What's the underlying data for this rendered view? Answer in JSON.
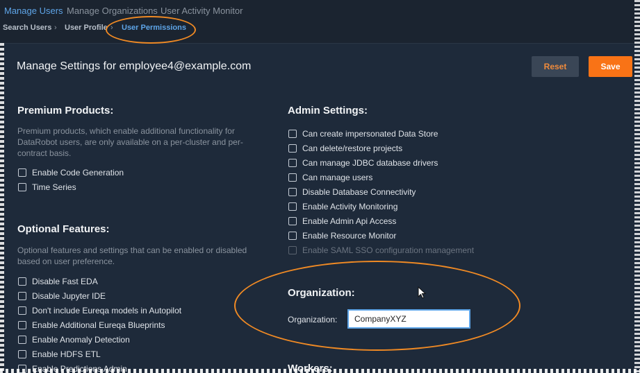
{
  "top_nav": {
    "tabs": [
      "Manage Users",
      "Manage Organizations",
      "User Activity Monitor"
    ],
    "active_tab": "Manage Users"
  },
  "breadcrumb": {
    "items": [
      "Search Users",
      "User Profile",
      "User Permissions"
    ],
    "separator": "›"
  },
  "panel": {
    "title": "Manage Settings for employee4@example.com",
    "reset_label": "Reset",
    "save_label": "Save"
  },
  "premium": {
    "title": "Premium Products:",
    "description": "Premium products, which enable additional functionality for DataRobot users, are only available on a per-cluster and per-contract basis.",
    "options": [
      "Enable Code Generation",
      "Time Series"
    ]
  },
  "optional": {
    "title": "Optional Features:",
    "description": "Optional features and settings that can be enabled or disabled based on user preference.",
    "options": [
      "Disable Fast EDA",
      "Disable Jupyter IDE",
      "Don't include Eureqa models in Autopilot",
      "Enable Additional Eureqa Blueprints",
      "Enable Anomaly Detection",
      "Enable HDFS ETL",
      "Enable Predictions Admin"
    ]
  },
  "admin": {
    "title": "Admin Settings:",
    "options": [
      "Can create impersonated Data Store",
      "Can delete/restore projects",
      "Can manage JDBC database drivers",
      "Can manage users",
      "Disable Database Connectivity",
      "Enable Activity Monitoring",
      "Enable Admin Api Access",
      "Enable Resource Monitor",
      "Enable SAML SSO configuration management"
    ]
  },
  "organization": {
    "title": "Organization:",
    "label": "Organization:",
    "value": "CompanyXYZ"
  },
  "workers": {
    "title": "Workers:"
  },
  "colors": {
    "accent": "#5ea5e8",
    "save": "#f97316",
    "annotation": "#f08a24",
    "panel_bg": "#1e2a3a"
  }
}
